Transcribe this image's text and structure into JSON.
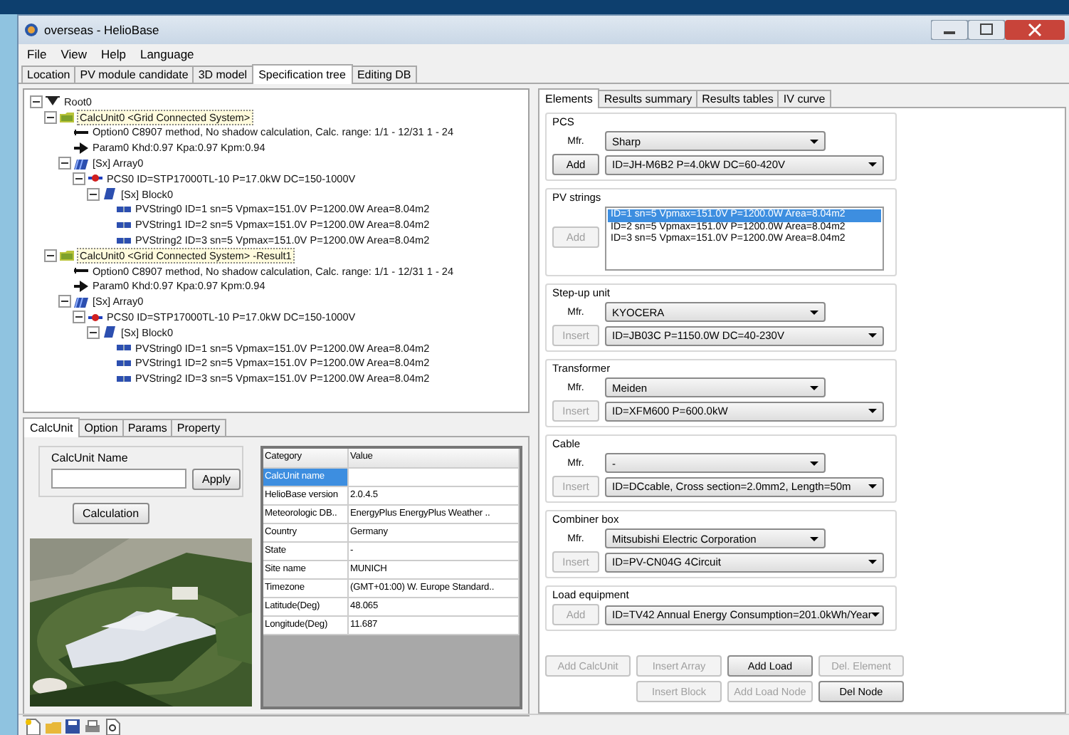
{
  "window": {
    "title": "overseas - HelioBase"
  },
  "menu": [
    "File",
    "View",
    "Help",
    "Language"
  ],
  "tabs": [
    {
      "label": "Location",
      "selected": false
    },
    {
      "label": "PV module candidate",
      "selected": false
    },
    {
      "label": "3D model",
      "selected": false
    },
    {
      "label": "Specification tree",
      "selected": true
    },
    {
      "label": "Editing DB",
      "selected": false
    }
  ],
  "tree": {
    "label": "Root0",
    "kind": "root",
    "expanded": true,
    "children": [
      {
        "label": "CalcUnit0 <Grid Connected System>",
        "kind": "calcunit",
        "expanded": true,
        "children": [
          {
            "label": "Option0 C8907 method, No shadow calculation, Calc. range: 1/1 - 12/31 1 - 24",
            "kind": "option"
          },
          {
            "label": "Param0 Khd:0.97 Kpa:0.97 Kpm:0.94",
            "kind": "param"
          },
          {
            "label": "[Sx] Array0",
            "kind": "array",
            "expanded": true,
            "children": [
              {
                "label": "PCS0 ID=STP17000TL-10 P=17.0kW DC=150-1000V",
                "kind": "pcs",
                "expanded": true,
                "children": [
                  {
                    "label": "[Sx] Block0",
                    "kind": "block",
                    "expanded": true,
                    "children": [
                      {
                        "label": "PVString0 ID=1 sn=5 Vpmax=151.0V P=1200.0W Area=8.04m2",
                        "kind": "string"
                      },
                      {
                        "label": "PVString1 ID=2 sn=5 Vpmax=151.0V P=1200.0W Area=8.04m2",
                        "kind": "string"
                      },
                      {
                        "label": "PVString2 ID=3 sn=5 Vpmax=151.0V P=1200.0W Area=8.04m2",
                        "kind": "string"
                      }
                    ]
                  }
                ]
              }
            ]
          }
        ]
      },
      {
        "label": "CalcUnit0 <Grid Connected System> -Result1",
        "kind": "calcunit",
        "expanded": true,
        "children": [
          {
            "label": "Option0 C8907 method, No shadow calculation, Calc. range: 1/1 - 12/31 1 - 24",
            "kind": "option"
          },
          {
            "label": "Param0 Khd:0.97 Kpa:0.97 Kpm:0.94",
            "kind": "param"
          },
          {
            "label": "[Sx] Array0",
            "kind": "array",
            "expanded": true,
            "children": [
              {
                "label": "PCS0 ID=STP17000TL-10 P=17.0kW DC=150-1000V",
                "kind": "pcs",
                "expanded": true,
                "children": [
                  {
                    "label": "[Sx] Block0",
                    "kind": "block",
                    "expanded": true,
                    "children": [
                      {
                        "label": "PVString0 ID=1 sn=5 Vpmax=151.0V P=1200.0W Area=8.04m2",
                        "kind": "string"
                      },
                      {
                        "label": "PVString1 ID=2 sn=5 Vpmax=151.0V P=1200.0W Area=8.04m2",
                        "kind": "string"
                      },
                      {
                        "label": "PVString2 ID=3 sn=5 Vpmax=151.0V P=1200.0W Area=8.04m2",
                        "kind": "string"
                      }
                    ]
                  }
                ]
              }
            ]
          }
        ]
      }
    ]
  },
  "lower_tabs": [
    {
      "label": "CalcUnit",
      "selected": true
    },
    {
      "label": "Option",
      "selected": false
    },
    {
      "label": "Params",
      "selected": false
    },
    {
      "label": "Property",
      "selected": false
    }
  ],
  "calcunit": {
    "group_title": "CalcUnit Name",
    "apply": "Apply",
    "calculation": "Calculation"
  },
  "properties": {
    "columns": [
      "Category",
      "Value"
    ],
    "rows": [
      {
        "category": "CalcUnit name",
        "selected": true
      },
      {
        "category": "HelioBase version",
        "value": "2.0.4.5",
        "selected": false
      },
      {
        "category": "Meteorologic DB..",
        "value": "EnergyPlus EnergyPlus Weather ..",
        "selected": false
      },
      {
        "category": "Country",
        "value": "Germany",
        "selected": false
      },
      {
        "category": "State",
        "value": "-",
        "selected": false
      },
      {
        "category": "Site name",
        "value": "MUNICH",
        "selected": false
      },
      {
        "category": "Timezone",
        "value": "(GMT+01:00) W. Europe Standard..",
        "selected": false
      },
      {
        "category": "Latitude(Deg)",
        "value": "48.065",
        "selected": false
      },
      {
        "category": "Longitude(Deg)",
        "value": "11.687",
        "selected": false
      }
    ]
  },
  "right_tabs": [
    {
      "label": "Elements",
      "selected": true
    },
    {
      "label": "Results summary",
      "selected": false
    },
    {
      "label": "Results tables",
      "selected": false
    },
    {
      "label": "IV curve",
      "selected": false
    }
  ],
  "groups": [
    {
      "title": "PCS",
      "kind": "combo",
      "mfr_label": "Mfr.",
      "mfr": "Sharp",
      "button": {
        "label": "Add",
        "disabled": false
      },
      "item": "ID=JH-M6B2 P=4.0kW DC=60-420V"
    },
    {
      "title": "PV strings",
      "kind": "list",
      "button": {
        "label": "Add",
        "disabled": true
      },
      "items": [
        {
          "label": "ID=1 sn=5 Vpmax=151.0V P=1200.0W Area=8.04m2",
          "selected": true
        },
        {
          "label": "ID=2 sn=5 Vpmax=151.0V P=1200.0W Area=8.04m2",
          "selected": false
        },
        {
          "label": "ID=3 sn=5 Vpmax=151.0V P=1200.0W Area=8.04m2",
          "selected": false
        }
      ]
    },
    {
      "title": "Step-up unit",
      "kind": "combo",
      "mfr_label": "Mfr.",
      "mfr": "KYOCERA",
      "button": {
        "label": "Insert",
        "disabled": true
      },
      "item": "ID=JB03C P=1150.0W DC=40-230V"
    },
    {
      "title": "Transformer",
      "kind": "combo",
      "mfr_label": "Mfr.",
      "mfr": "Meiden",
      "button": {
        "label": "Insert",
        "disabled": true
      },
      "item": "ID=XFM600 P=600.0kW"
    },
    {
      "title": "Cable",
      "kind": "combo",
      "mfr_label": "Mfr.",
      "mfr": "-",
      "button": {
        "label": "Insert",
        "disabled": true
      },
      "item": "ID=DCcable, Cross section=2.0mm2, Length=50m"
    },
    {
      "title": "Combiner box",
      "kind": "combo",
      "mfr_label": "Mfr.",
      "mfr": "Mitsubishi Electric Corporation",
      "button": {
        "label": "Insert",
        "disabled": true
      },
      "item": "ID=PV-CN04G 4Circuit"
    },
    {
      "title": "Load equipment",
      "kind": "combo",
      "button": {
        "label": "Add",
        "disabled": true
      },
      "item": "ID=TV42 Annual Energy Consumption=201.0kWh/Year"
    }
  ],
  "actions": [
    [
      {
        "label": "Add CalcUnit",
        "disabled": true
      },
      {
        "label": "Insert Array",
        "disabled": true
      },
      {
        "label": "Add Load",
        "disabled": false
      },
      {
        "label": "Del. Element",
        "disabled": true
      }
    ],
    [
      {
        "label": "Insert Block",
        "disabled": true
      },
      {
        "label": "Add Load Node",
        "disabled": true
      },
      {
        "label": "Del Node",
        "disabled": false
      }
    ]
  ]
}
